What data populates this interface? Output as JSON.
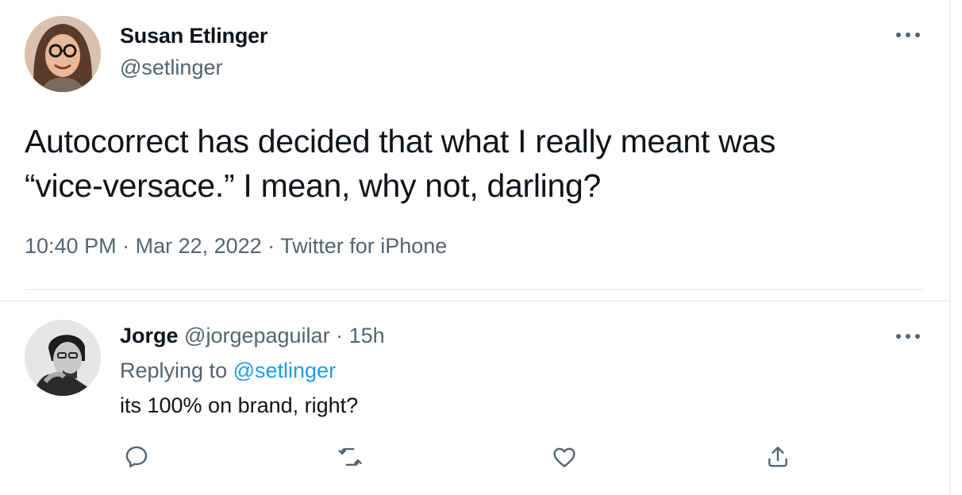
{
  "main_tweet": {
    "display_name": "Susan Etlinger",
    "handle": "@setlinger",
    "text": "Autocorrect has decided that what I really meant was\n“vice-versace.” I mean, why not, darling?",
    "time": "10:40 PM",
    "dot1": " · ",
    "date": "Mar 22, 2022",
    "dot2": " · ",
    "source": "Twitter for iPhone",
    "more_icon": "ellipsis-icon"
  },
  "reply": {
    "display_name": "Jorge",
    "handle": "@jorgepaguilar",
    "dot": " · ",
    "age": "15h",
    "replying_prefix": "Replying to ",
    "replying_to": "@setlinger",
    "text": "its 100% on brand, right?",
    "actions": [
      "reply-icon",
      "retweet-icon",
      "like-icon",
      "share-icon"
    ]
  },
  "colors": {
    "text_primary": "#0f1419",
    "text_secondary": "#536471",
    "link": "#1d9bf0",
    "divider": "#eff3f4"
  }
}
